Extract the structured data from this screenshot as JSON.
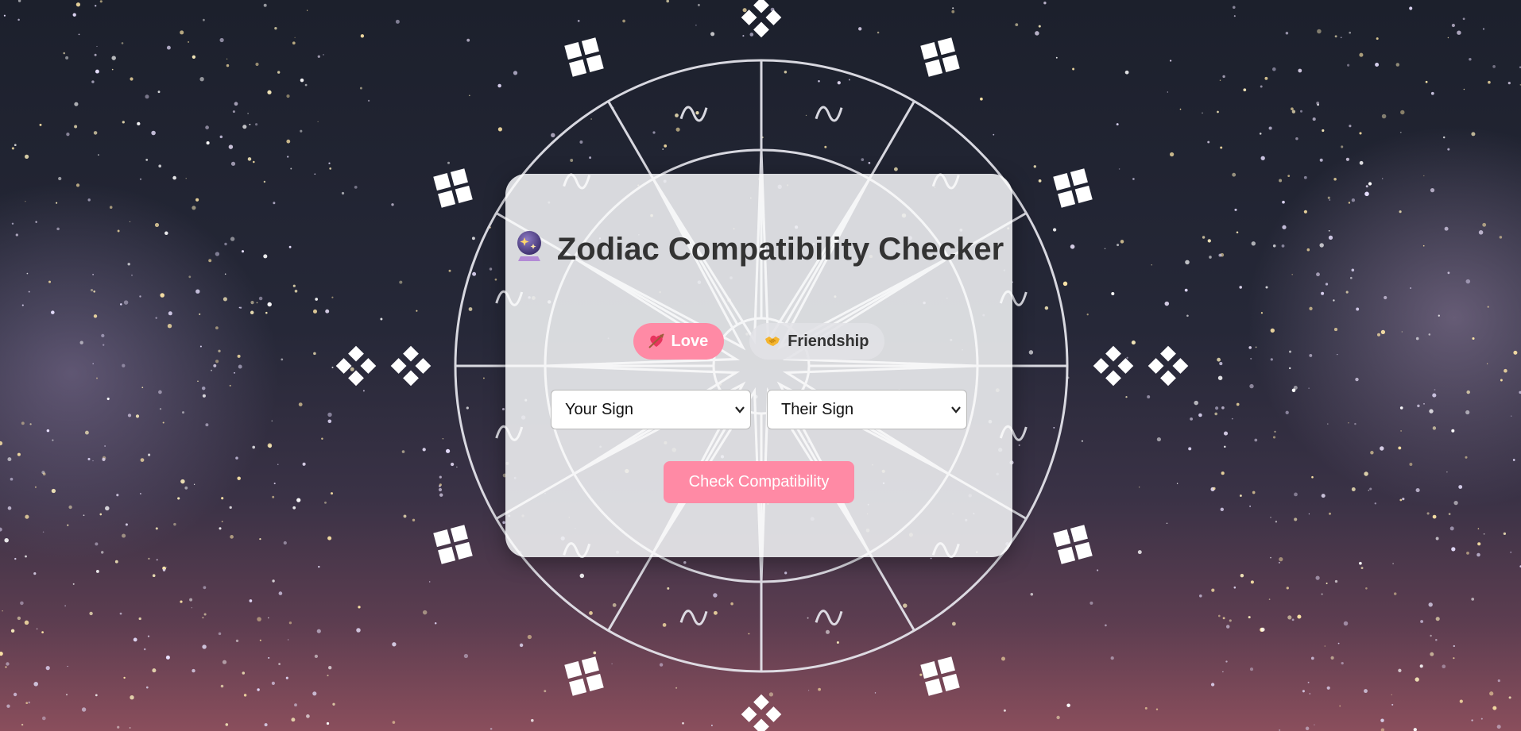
{
  "page": {
    "title": "Zodiac Compatibility Checker",
    "title_icon": "crystal-ball-icon"
  },
  "tabs": [
    {
      "label": "Love",
      "icon": "heart-arrow-icon",
      "active": true
    },
    {
      "label": "Friendship",
      "icon": "handshake-icon",
      "active": false
    }
  ],
  "selects": {
    "your_sign": "Your Sign",
    "their_sign": "Their Sign"
  },
  "actions": {
    "check_label": "Check Compatibility"
  },
  "colors": {
    "accent": "#ff8aa5",
    "text": "#333333",
    "card": "#ecedf0",
    "sky_top": "#1d2230",
    "sky_bottom": "#7a4858"
  }
}
